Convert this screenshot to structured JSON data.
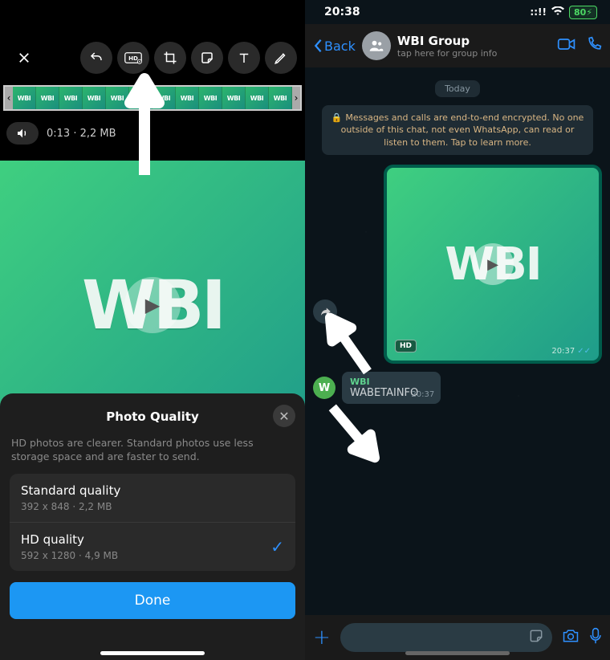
{
  "left": {
    "strip_text": "WBI",
    "meta": "0:13 · 2,2 MB",
    "preview_text": "WBI",
    "sheet": {
      "title": "Photo Quality",
      "subtitle": "HD photos are clearer. Standard photos use less storage space and are faster to send.",
      "options": [
        {
          "title": "Standard quality",
          "subtitle": "392 x 848 · 2,2 MB",
          "selected": false
        },
        {
          "title": "HD quality",
          "subtitle": "592 x 1280 · 4,9 MB",
          "selected": true
        }
      ],
      "done": "Done"
    }
  },
  "right": {
    "status": {
      "time": "20:38",
      "battery": "80"
    },
    "header": {
      "back": "Back",
      "name": "WBI Group",
      "sub": "tap here for group info"
    },
    "date": "Today",
    "e2e": "Messages and calls are end-to-end encrypted. No one outside of this chat, not even WhatsApp, can read or listen to them. Tap to learn more.",
    "message": {
      "text": "WBI",
      "hd": "HD",
      "time": "20:37"
    },
    "quote": {
      "avatar": "W",
      "name": "WBI",
      "text": "WABETAINFO",
      "time": "20:37"
    }
  }
}
